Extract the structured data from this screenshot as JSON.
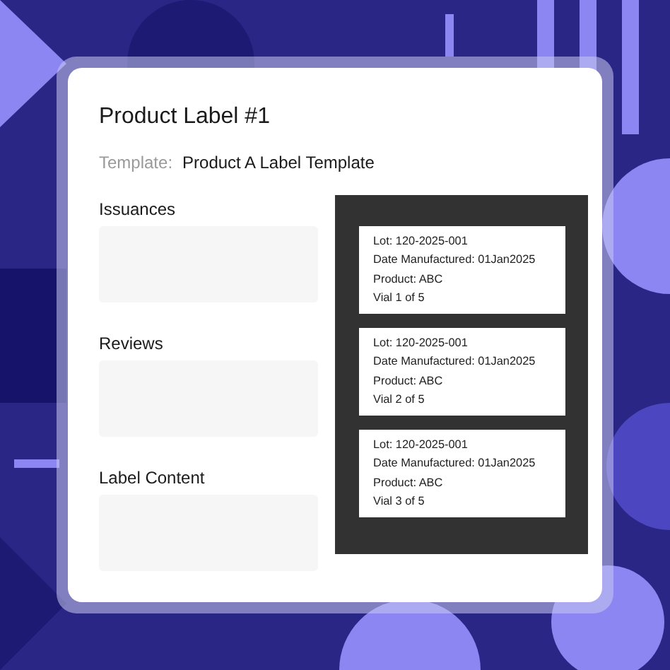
{
  "title": "Product Label #1",
  "template": {
    "label": "Template:",
    "value": "Product A Label Template"
  },
  "sections": [
    {
      "label": "Issuances"
    },
    {
      "label": "Reviews"
    },
    {
      "label": "Label Content"
    }
  ],
  "labels": [
    {
      "lines": [
        "Lot: 120-2025-001",
        "Date Manufactured: 01Jan2025",
        "Product: ABC",
        "Vial 1 of 5"
      ]
    },
    {
      "lines": [
        "Lot: 120-2025-001",
        "Date Manufactured: 01Jan2025",
        "Product: ABC",
        "Vial 2 of 5"
      ]
    },
    {
      "lines": [
        "Lot: 120-2025-001",
        "Date Manufactured: 01Jan2025",
        "Product: ABC",
        "Vial 3 of 5"
      ]
    }
  ]
}
